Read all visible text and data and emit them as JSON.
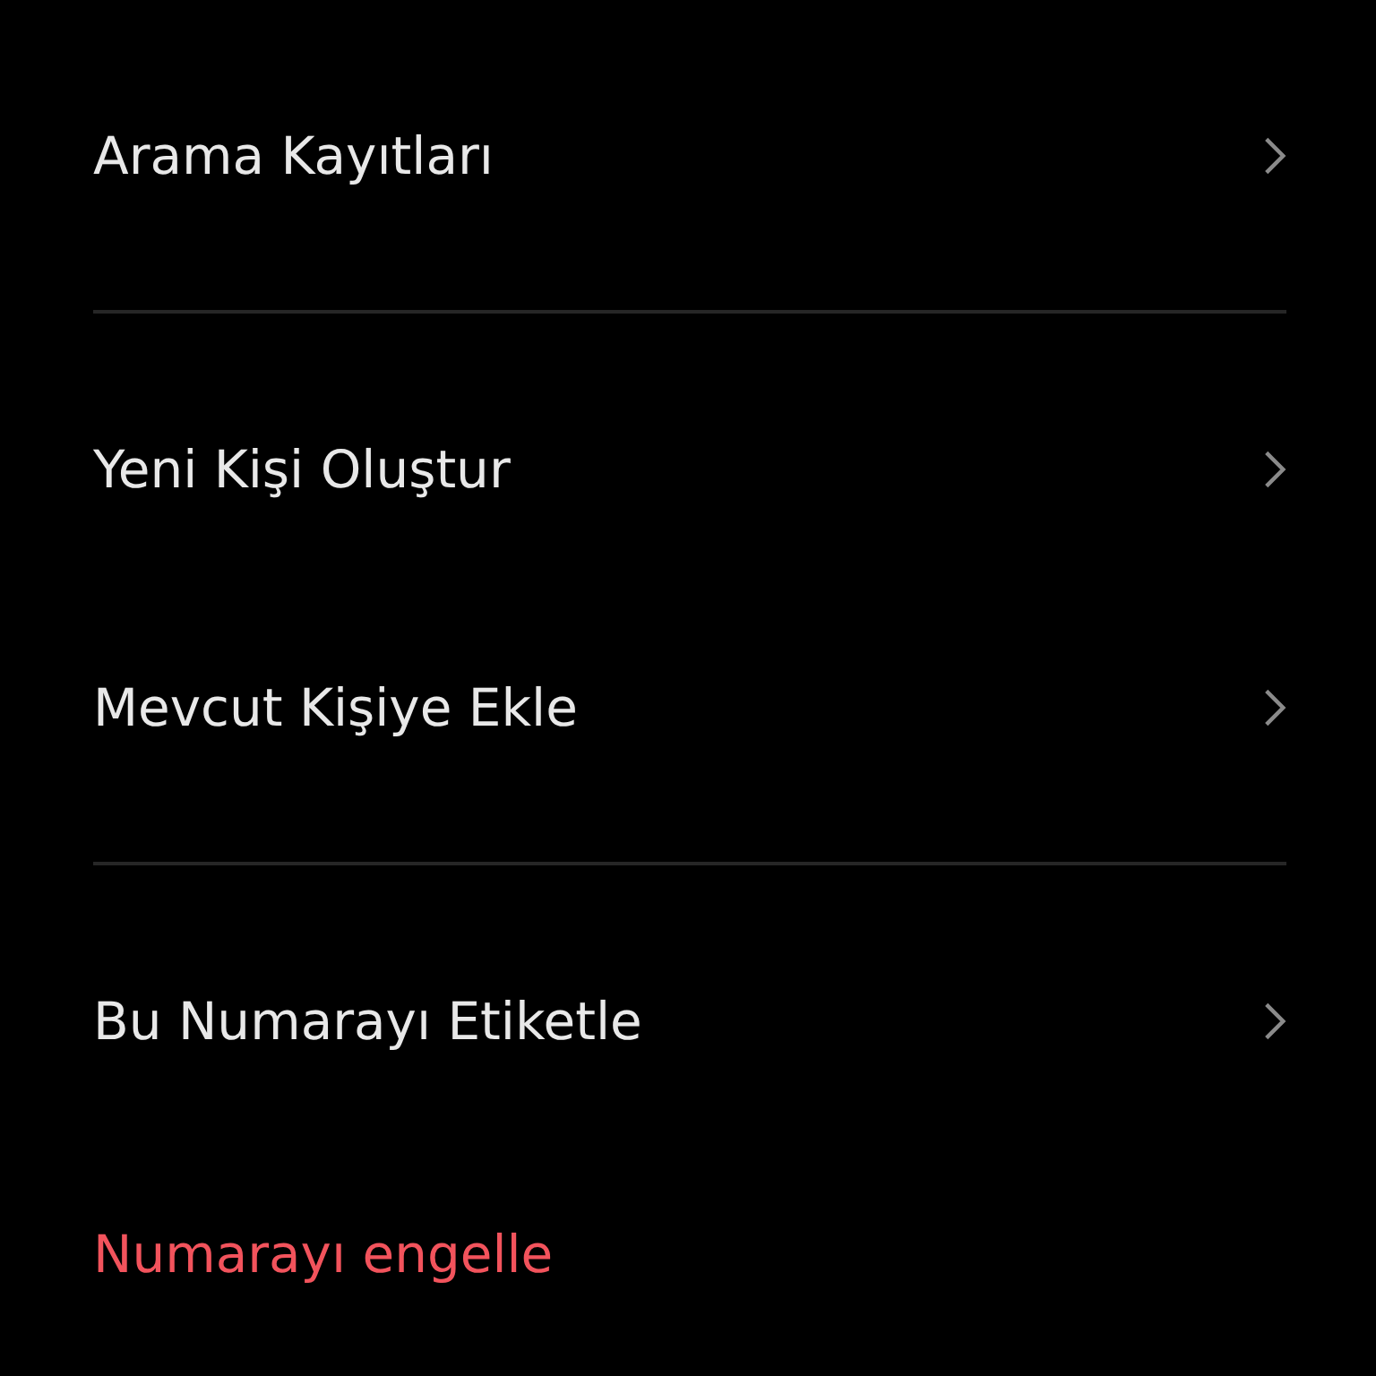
{
  "sections": [
    {
      "items": [
        {
          "label": "Arama Kayıtları",
          "kind": "link"
        }
      ]
    },
    {
      "items": [
        {
          "label": "Yeni Kişi Oluştur",
          "kind": "link"
        },
        {
          "label": "Mevcut Kişiye Ekle",
          "kind": "link"
        }
      ]
    },
    {
      "items": [
        {
          "label": "Bu Numarayı Etiketle",
          "kind": "link"
        },
        {
          "label": "Numarayı engelle",
          "kind": "danger"
        }
      ]
    }
  ]
}
